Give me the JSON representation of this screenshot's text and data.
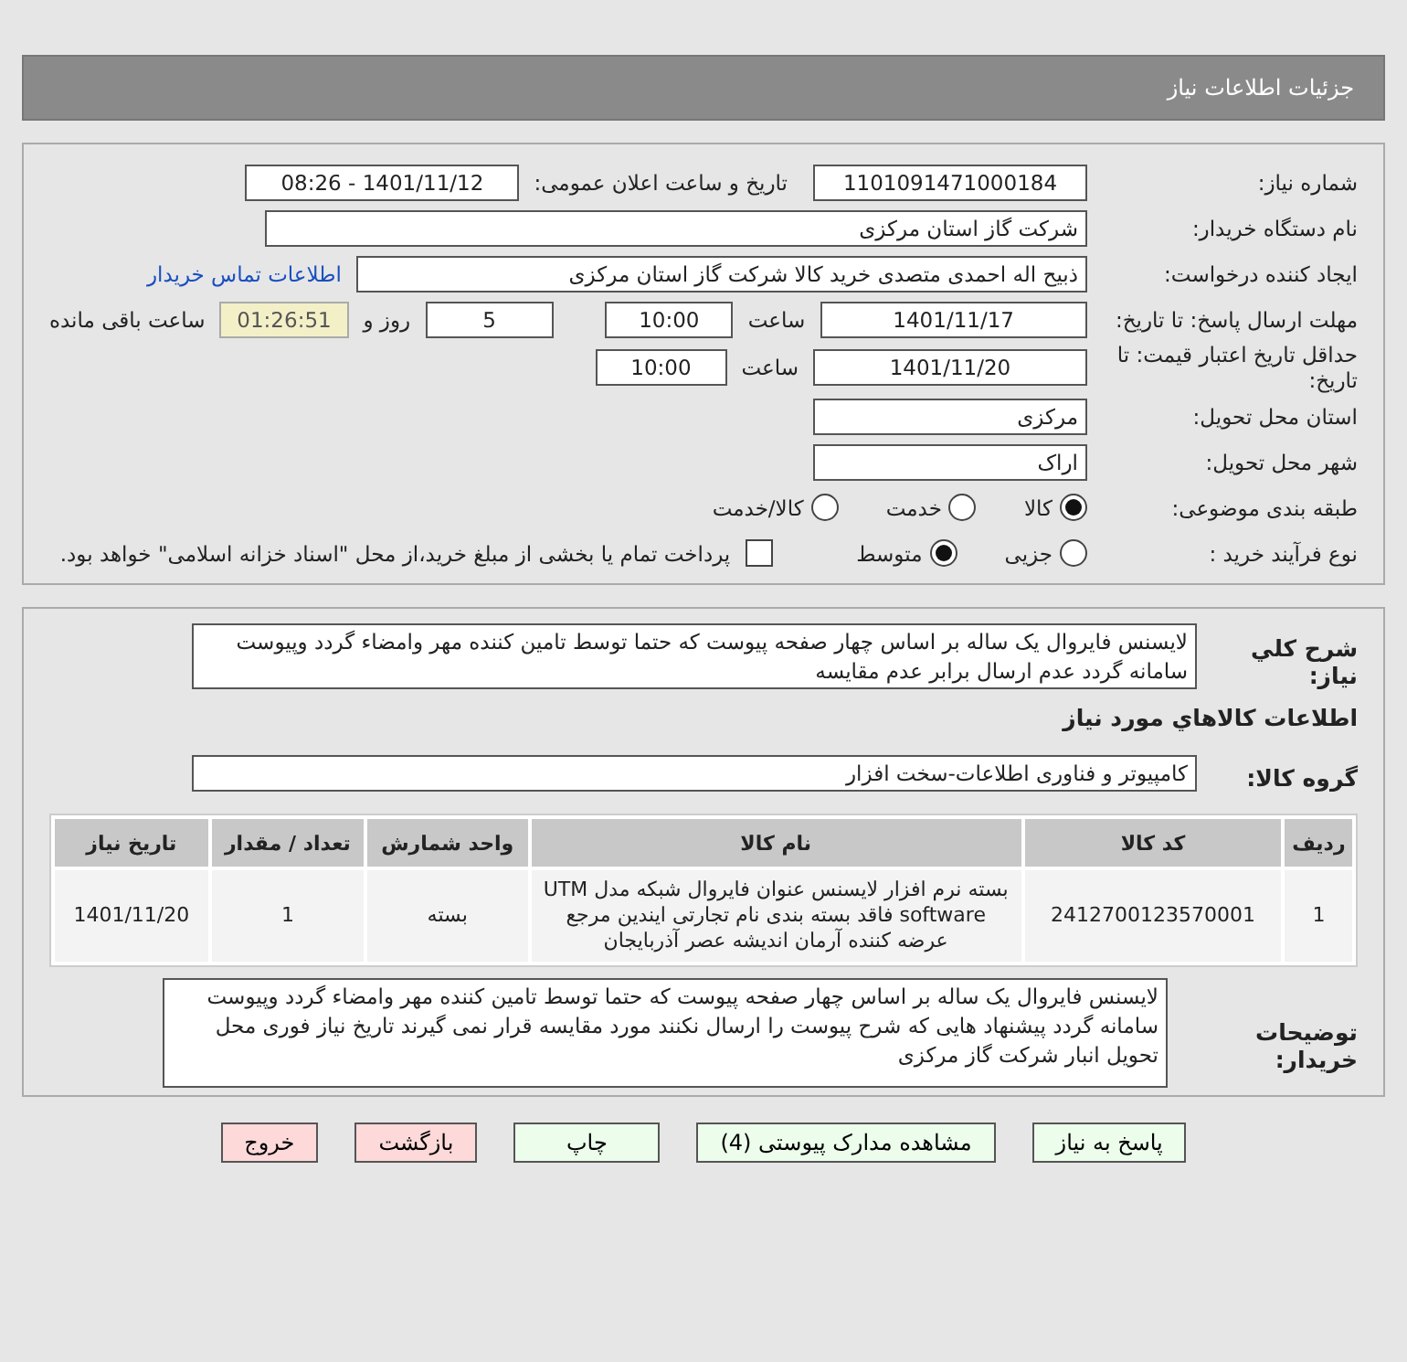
{
  "header": {
    "title": "جزئیات اطلاعات نیاز"
  },
  "need_number": {
    "label": "شماره نیاز:",
    "value": "1101091471000184"
  },
  "announce": {
    "label": "تاریخ و ساعت اعلان عمومی:",
    "value": "1401/11/12 - 08:26"
  },
  "buyer_org": {
    "label": "نام دستگاه خریدار:",
    "value": "شرکت گاز استان مرکزی"
  },
  "creator": {
    "label": "ایجاد کننده درخواست:",
    "value": "ذبیح اله احمدی متصدی خرید کالا شرکت گاز استان مرکزی",
    "link": "اطلاعات تماس خریدار"
  },
  "deadline": {
    "label": "مهلت ارسال پاسخ: تا تاریخ:",
    "date": "1401/11/17",
    "time_label": "ساعت",
    "time": "10:00",
    "days": "5",
    "days_label": "روز و",
    "remaining": "01:26:51",
    "remaining_label": "ساعت باقی مانده"
  },
  "validity": {
    "label": "حداقل تاریخ اعتبار قیمت: تا تاریخ:",
    "date": "1401/11/20",
    "time_label": "ساعت",
    "time": "10:00"
  },
  "province": {
    "label": "استان محل تحویل:",
    "value": "مرکزی"
  },
  "city": {
    "label": "شهر محل تحویل:",
    "value": "اراک"
  },
  "category": {
    "label": "طبقه بندی موضوعی:",
    "options": [
      {
        "label": "کالا",
        "selected": true
      },
      {
        "label": "خدمت",
        "selected": false
      },
      {
        "label": "کالا/خدمت",
        "selected": false
      }
    ]
  },
  "process": {
    "label": "نوع فرآیند خرید :",
    "options": [
      {
        "label": "جزیی",
        "selected": false
      },
      {
        "label": "متوسط",
        "selected": true
      }
    ],
    "payment": {
      "label": "پرداخت تمام یا بخشی از مبلغ خرید،از محل \"اسناد خزانه اسلامی\" خواهد بود.",
      "checked": false
    }
  },
  "description": {
    "label": "شرح كلي نياز:",
    "value": "لایسنس فایروال یک ساله بر اساس چهار صفحه پیوست که حتما توسط تامین کننده مهر وامضاء گردد وپیوست سامانه گردد عدم ارسال برابر عدم مقایسه"
  },
  "goods_heading": "اطلاعات كالاهاي مورد نياز",
  "goods_group": {
    "label": "گروه کالا:",
    "value": "کامپیوتر و فناوری اطلاعات-سخت افزار"
  },
  "table": {
    "columns": [
      "ردیف",
      "کد کالا",
      "نام کالا",
      "واحد شمارش",
      "تعداد / مقدار",
      "تاریخ نیاز"
    ],
    "rows": [
      [
        "1",
        "2412700123570001",
        "بسته نرم افزار لایسنس عنوان فایروال شبکه مدل UTM software فاقد بسته بندی نام تجارتی ایندین مرجع عرضه کننده آرمان اندیشه عصر آذربایجان",
        "بسته",
        "1",
        "1401/11/20"
      ]
    ]
  },
  "buyer_notes": {
    "label": "توضیحات خریدار:",
    "value": "لایسنس فایروال یک ساله بر اساس چهار صفحه پیوست که حتما توسط تامین کننده مهر وامضاء گردد وپیوست سامانه گردد پیشنهاد هایی که شرح پیوست را ارسال نکنند مورد مقایسه قرار نمی گیرند تاریخ نیاز فوری   محل تحویل انبار شرکت گاز مرکزی"
  },
  "buttons": [
    {
      "label": "پاسخ به نیاز",
      "kind": "primary"
    },
    {
      "label": "مشاهده مدارک پیوستی (4)",
      "kind": "primary"
    },
    {
      "label": "چاپ",
      "kind": "primary"
    },
    {
      "label": "بازگشت",
      "kind": "danger"
    },
    {
      "label": "خروج",
      "kind": "danger"
    }
  ]
}
